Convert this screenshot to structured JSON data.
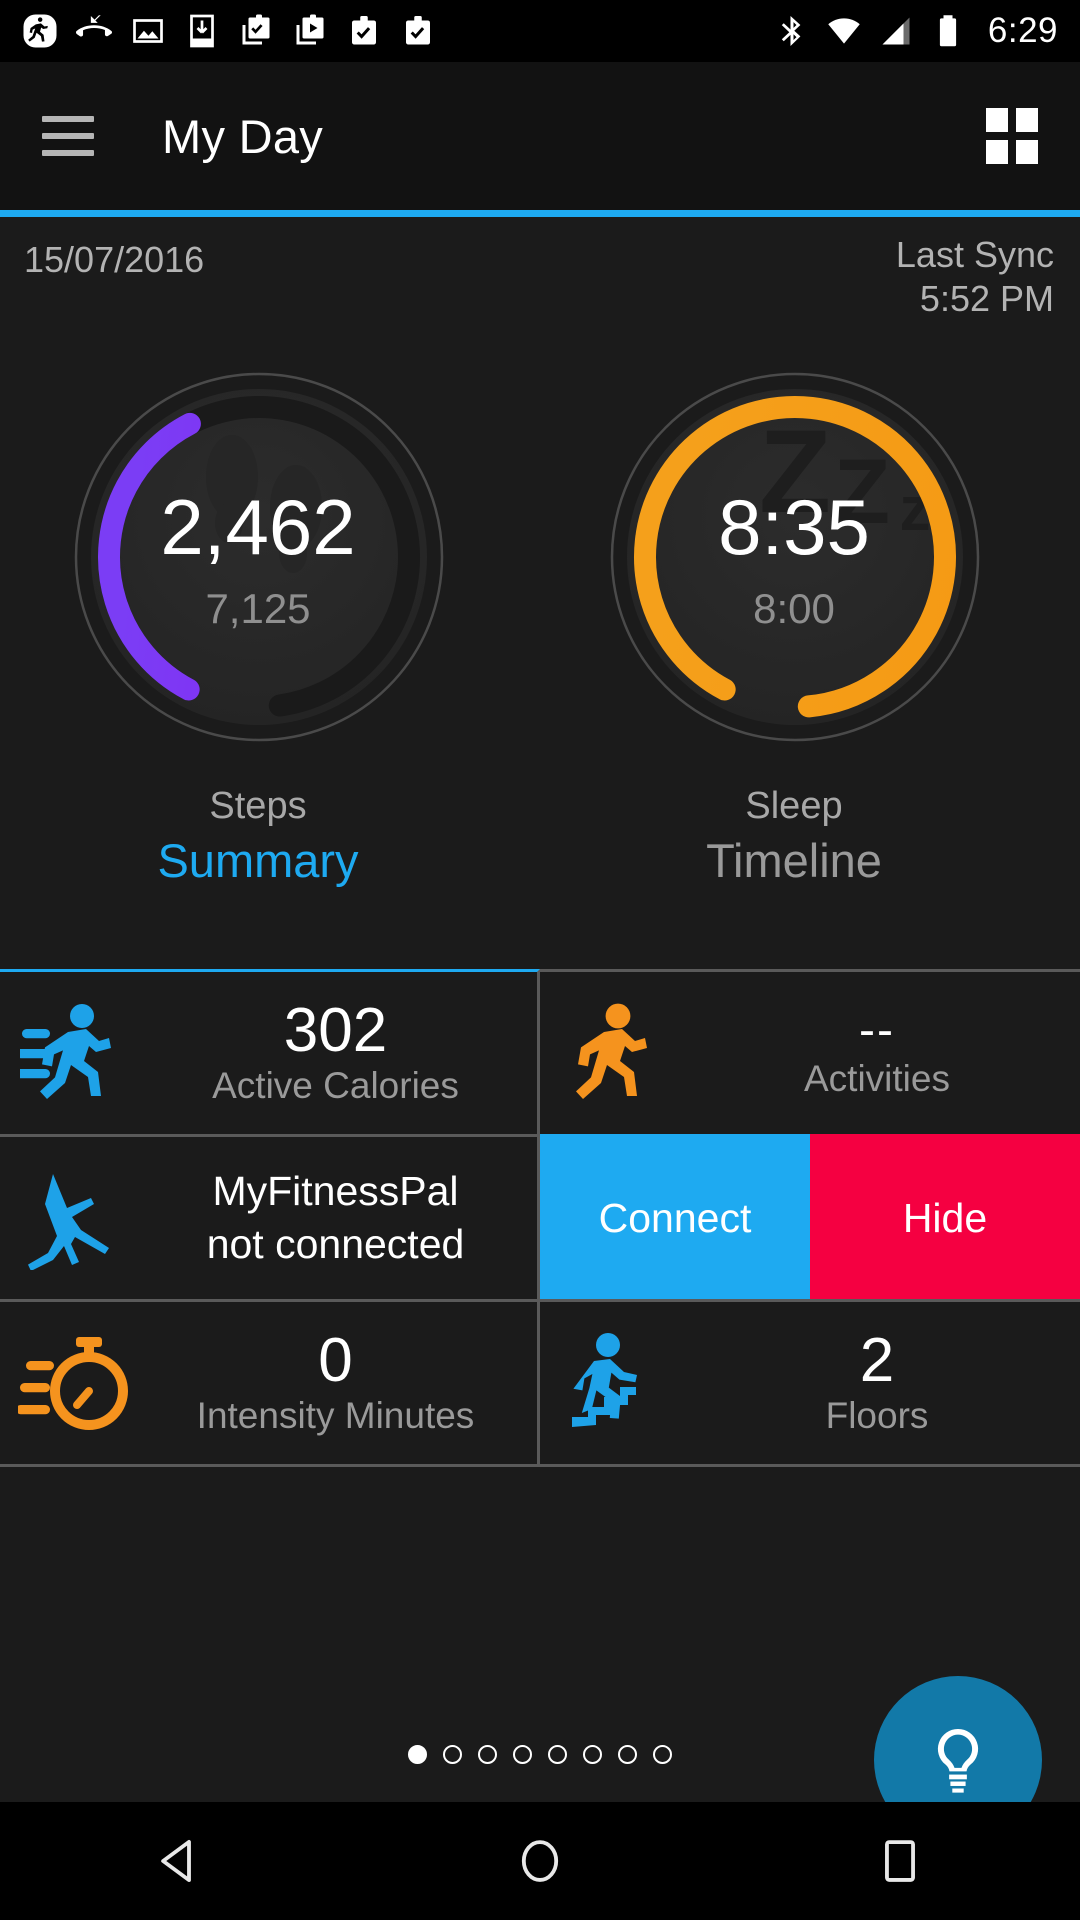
{
  "status_bar": {
    "time": "6:29",
    "notification_icons": [
      "running-app-icon",
      "missed-call-icon",
      "image-icon",
      "download-to-device-icon",
      "work-clipboard-check-stack-icon",
      "work-clipboard-play-stack-icon",
      "work-briefcase-check-icon",
      "work-briefcase-check-icon"
    ],
    "system_icons": [
      "bluetooth-icon",
      "wifi-icon",
      "cellular-signal-icon",
      "battery-icon"
    ]
  },
  "app_bar": {
    "menu_icon": "hamburger-menu-icon",
    "title": "My Day",
    "action_icon": "grid-view-icon"
  },
  "header": {
    "date": "15/07/2016",
    "sync_label": "Last Sync",
    "sync_time": "5:52 PM",
    "accent_color": "#1eaaf1"
  },
  "gauges": [
    {
      "key": "steps",
      "label": "Steps",
      "value": "2,462",
      "goal": "7,125",
      "watermark_icon": "footprints-icon",
      "arc_color": "#8a1ff0",
      "arc_color_2": "#7b3df5",
      "progress_pct": 34.6,
      "track_color": "#232323"
    },
    {
      "key": "sleep",
      "label": "Sleep",
      "value": "8:35",
      "goal": "8:00",
      "watermark_icon": "zzz-sleep-icon",
      "arc_color": "#f59a14",
      "arc_color_2": "#f5a01b",
      "progress_pct": 107.3,
      "track_color": "#232323"
    }
  ],
  "tabs": [
    {
      "label": "Summary",
      "active": true
    },
    {
      "label": "Timeline",
      "active": false
    }
  ],
  "tiles": [
    {
      "icon": "running-person-lines-icon",
      "icon_color": "#1ea2e8",
      "value": "302",
      "label": "Active Calories",
      "accent_top": true
    },
    {
      "icon": "running-person-icon",
      "icon_color": "#f5931e",
      "value": "--",
      "label": "Activities",
      "accent_top": false
    },
    {
      "icon": "myfitnesspal-figure-icon",
      "icon_color": "#1ea2e8",
      "two_line": "MyFitnessPal\nnot connected",
      "line1": "MyFitnessPal",
      "line2": "not connected"
    },
    {
      "connect_label": "Connect",
      "hide_label": "Hide",
      "connect_color": "#1eaaf1",
      "hide_color": "#f50041"
    },
    {
      "icon": "stopwatch-lines-icon",
      "icon_color": "#f5931e",
      "value": "0",
      "label": "Intensity Minutes",
      "accent_top": false
    },
    {
      "icon": "stairs-climb-icon",
      "icon_color": "#1ea2e8",
      "value": "2",
      "label": "Floors",
      "accent_top": false
    }
  ],
  "pager": {
    "total": 8,
    "current": 1
  },
  "fab": {
    "icon": "lightbulb-icon",
    "color": "#1279a8"
  },
  "nav_bar": {
    "back": "back-triangle-icon",
    "home": "home-circle-icon",
    "recents": "recents-square-icon"
  }
}
